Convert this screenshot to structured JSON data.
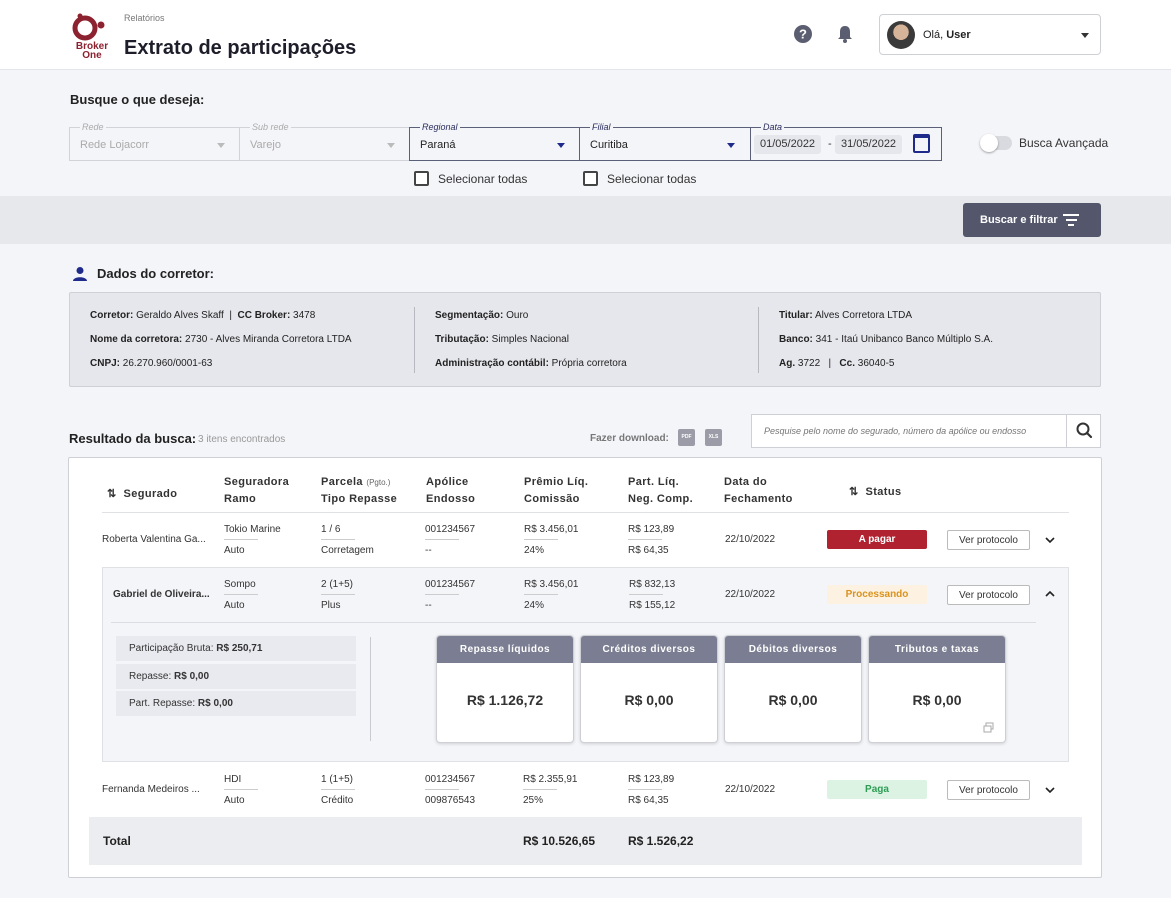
{
  "header": {
    "logo_text": "Broker One",
    "breadcrumb": "Relatórios",
    "title": "Extrato de participações",
    "user_greeting": "Olá, ",
    "user_name": "User",
    "icons": [
      "help-icon",
      "bell-icon",
      "chevron-down-icon"
    ]
  },
  "search": {
    "title": "Busque o que deseja:",
    "fields": {
      "rede": {
        "label": "Rede",
        "value": "Rede Lojacorr"
      },
      "subrede": {
        "label": "Sub rede",
        "value": "Varejo"
      },
      "regional": {
        "label": "Regional",
        "value": "Paraná"
      },
      "filial": {
        "label": "Filial",
        "value": "Curitiba"
      },
      "data": {
        "label": "Data",
        "start": "01/05/2022",
        "sep": "-",
        "end": "31/05/2022"
      }
    },
    "select_all_1": "Selecionar todas",
    "select_all_2": "Selecionar todas",
    "advanced_label": "Busca Avançada",
    "advanced_on": false,
    "filter_button": "Buscar e filtrar"
  },
  "broker": {
    "title": "Dados do corretor:",
    "col1": {
      "l1k": "Corretor:",
      "l1v": " Geraldo Alves Skaff",
      "l1sep": "  |  ",
      "l1k2": "CC Broker:",
      "l1v2": " 3478",
      "l2k": "Nome da corretora:",
      "l2v": " 2730 - Alves Miranda Corretora LTDA",
      "l3k": "CNPJ:",
      "l3v": " 26.270.960/0001-63"
    },
    "col2": {
      "l1k": "Segmentação:",
      "l1v": " Ouro",
      "l2k": "Tributação:",
      "l2v": " Simples Nacional",
      "l3k": "Administração contábil:",
      "l3v": " Própria corretora"
    },
    "col3": {
      "l1k": "Titular:",
      "l1v": " Alves Corretora LTDA",
      "l2k": "Banco:",
      "l2v": " 341 - Itaú Unibanco Banco Múltiplo S.A.",
      "l3k": "Ag.",
      "l3v": " 3722",
      "l3sep": "   |   ",
      "l3k2": "Cc.",
      "l3v2": " 36040-5"
    }
  },
  "results": {
    "title": "Resultado da busca:",
    "count": "3 itens encontrados",
    "download_label": "Fazer download:",
    "pdf_label": "PDF",
    "xls_label": "XLS",
    "search_placeholder": "Pesquise pelo nome do segurado, número da apólice ou endosso"
  },
  "table": {
    "headers": {
      "segurado": "Segurado",
      "seguradora": "Seguradora",
      "ramo": "Ramo",
      "parcela": "Parcela",
      "pgto": "(Pgto.)",
      "tipo_repasse": "Tipo Repasse",
      "apolice": "Apólice",
      "endosso": "Endosso",
      "premio": "Prêmio Líq.",
      "comissao": "Comissão",
      "part": "Part. Líq.",
      "neg": "Neg. Comp.",
      "data": "Data do",
      "fechamento": "Fechamento",
      "status": "Status"
    },
    "rows": [
      {
        "segurado": "Roberta Valentina Ga...",
        "seguradora": "Tokio Marine",
        "ramo": "Auto",
        "parcela": "1 / 6",
        "tipo": "Corretagem",
        "apolice": "001234567",
        "endosso": "--",
        "premio": "R$ 3.456,01",
        "comissao": "24%",
        "part": "R$ 123,89",
        "neg": "R$ 64,35",
        "data": "22/10/2022",
        "status": "A pagar",
        "protocolo": "Ver protocolo"
      },
      {
        "segurado": "Gabriel de Oliveira...",
        "seguradora": "Sompo",
        "ramo": "Auto",
        "parcela": "2 (1+5)",
        "tipo": "Plus",
        "apolice": "001234567",
        "endosso": "--",
        "premio": "R$ 3.456,01",
        "comissao": "24%",
        "part": "R$ 832,13",
        "neg": "R$ 155,12",
        "data": "22/10/2022",
        "status": "Processando",
        "protocolo": "Ver protocolo"
      },
      {
        "segurado": "Fernanda Medeiros ...",
        "seguradora": "HDI",
        "ramo": "Auto",
        "parcela": "1 (1+5)",
        "tipo": "Crédito",
        "apolice": "001234567",
        "endosso": "009876543",
        "premio": "R$ 2.355,91",
        "comissao": "25%",
        "part": "R$ 123,89",
        "neg": "R$ 64,35",
        "data": "22/10/2022",
        "status": "Paga",
        "protocolo": "Ver protocolo"
      }
    ],
    "status_colors": {
      "A pagar": "#b0222f",
      "Processando": "#fdf1e1",
      "Paga": "#dcf3e4"
    },
    "expanded": {
      "bruta_k": "Participação Bruta:",
      "bruta_v": " R$ 250,71",
      "repasse_k": "Repasse:",
      "repasse_v": " R$ 0,00",
      "part_repasse_k": "Part. Repasse:",
      "part_repasse_v": " R$ 0,00",
      "cards": [
        {
          "title": "Repasse líquidos",
          "value": "R$ 1.126,72"
        },
        {
          "title": "Créditos diversos",
          "value": "R$ 0,00"
        },
        {
          "title": "Débitos diversos",
          "value": "R$ 0,00"
        },
        {
          "title": "Tributos e taxas",
          "value": "R$ 0,00"
        }
      ]
    },
    "total": {
      "label": "Total",
      "premio": "R$ 10.526,65",
      "part": "R$ 1.526,22"
    }
  }
}
